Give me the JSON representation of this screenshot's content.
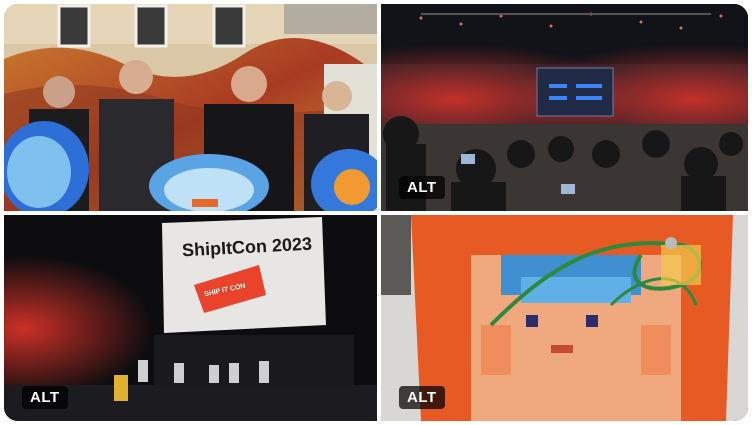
{
  "tiles": [
    {
      "id": "team-photo",
      "alt_label": ""
    },
    {
      "id": "audience-photo",
      "alt_label": "ALT"
    },
    {
      "id": "stage-photo",
      "alt_label": "ALT",
      "screen_title": "ShipItCon 2023",
      "logo_text": "SHIP IT CON"
    },
    {
      "id": "card-photo",
      "alt_label": "ALT"
    }
  ],
  "colors": {
    "border": "#ffffff",
    "badge_bg": "#000000",
    "stage_red": "#e9432b",
    "card_orange": "#e85a24"
  }
}
